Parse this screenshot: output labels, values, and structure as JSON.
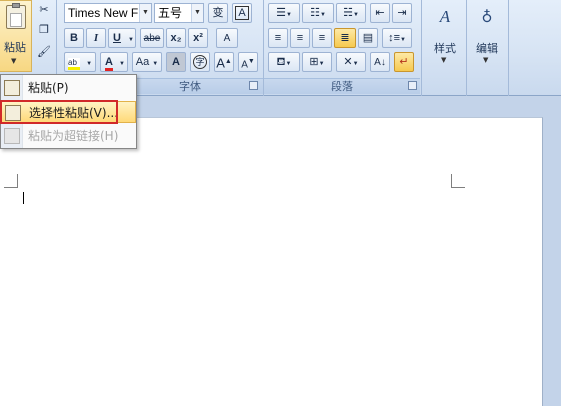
{
  "clipboard": {
    "paste_label": "粘贴"
  },
  "font": {
    "font_name": "Times New F",
    "font_size": "五号",
    "group_label": "字体",
    "bold": "B",
    "italic": "I",
    "underline": "U",
    "strikethrough": "abe",
    "subscript": "x₂",
    "superscript": "x²",
    "change_case": "Aa",
    "grow_font": "A",
    "shrink_font": "A",
    "char_border": "A",
    "enclose": "字",
    "phonetic": "变",
    "clear_format": "A"
  },
  "paragraph": {
    "group_label": "段落"
  },
  "styles": {
    "label": "样式"
  },
  "editing": {
    "label": "编辑"
  },
  "context_menu": {
    "items": [
      {
        "label": "粘贴(P)",
        "state": "normal"
      },
      {
        "label": "选择性粘贴(V)...",
        "state": "hover"
      },
      {
        "label": "粘贴为超链接(H)",
        "state": "disabled"
      }
    ]
  },
  "colors": {
    "highlight_border": "#d12929",
    "hover_fill": "#ffd978",
    "page": "#ffffff"
  }
}
